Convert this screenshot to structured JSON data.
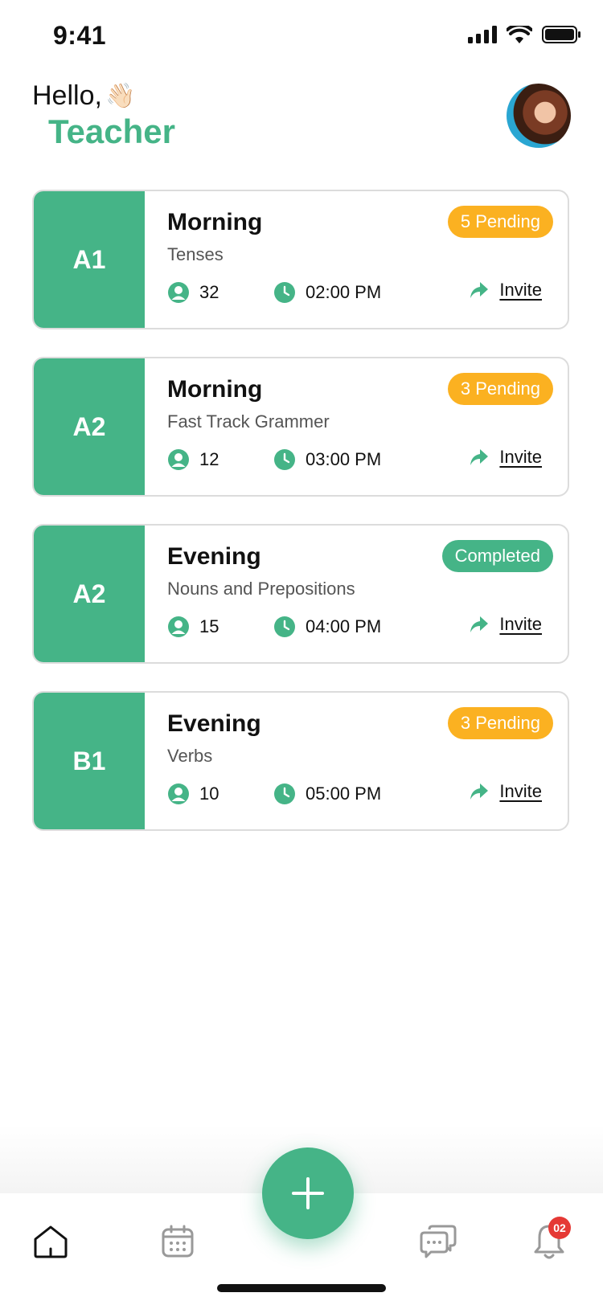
{
  "status_bar": {
    "time": "9:41"
  },
  "header": {
    "greeting": "Hello,",
    "wave_emoji": "👋🏻",
    "name": "Teacher"
  },
  "colors": {
    "primary": "#45b487",
    "pending": "#fbb121",
    "danger": "#e53935"
  },
  "classes": [
    {
      "level": "A1",
      "session": "Morning",
      "topic": "Tenses",
      "status": "5 Pending",
      "status_type": "pending",
      "students": "32",
      "time": "02:00 PM",
      "invite_label": "Invite"
    },
    {
      "level": "A2",
      "session": "Morning",
      "topic": "Fast Track Grammer",
      "status": "3 Pending",
      "status_type": "pending",
      "students": "12",
      "time": "03:00 PM",
      "invite_label": "Invite"
    },
    {
      "level": "A2",
      "session": "Evening",
      "topic": "Nouns and Prepositions",
      "status": "Completed",
      "status_type": "completed",
      "students": "15",
      "time": "04:00 PM",
      "invite_label": "Invite"
    },
    {
      "level": "B1",
      "session": "Evening",
      "topic": "Verbs",
      "status": "3 Pending",
      "status_type": "pending",
      "students": "10",
      "time": "05:00 PM",
      "invite_label": "Invite"
    }
  ],
  "bottom_nav": {
    "items": [
      "home-icon",
      "calendar-icon",
      "add-icon",
      "chat-icon",
      "bell-icon"
    ],
    "notification_count": "02"
  }
}
